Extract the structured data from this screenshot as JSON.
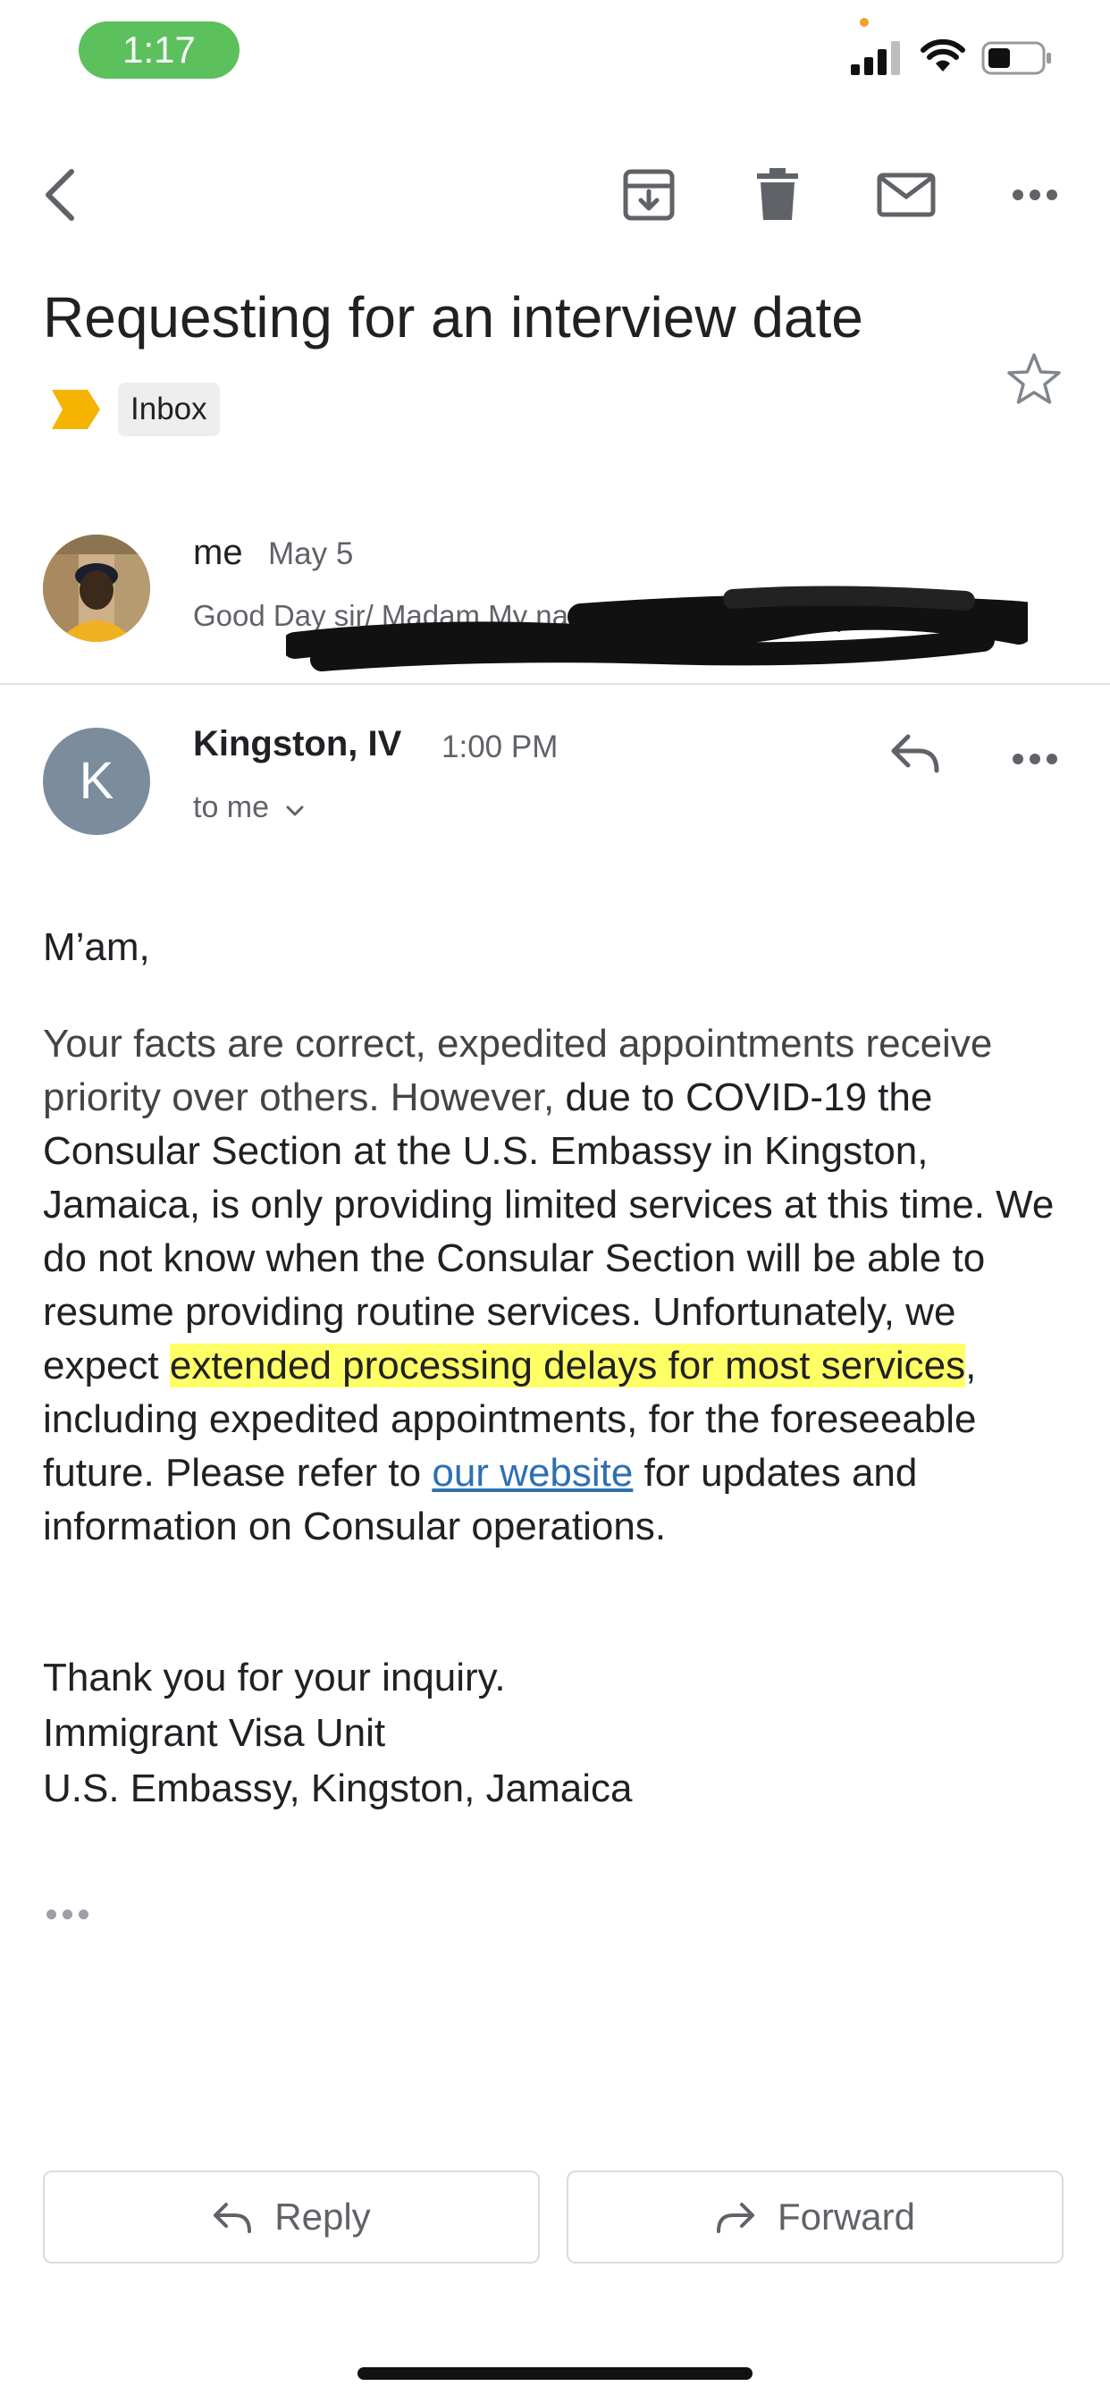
{
  "status_bar": {
    "time": "1:17",
    "icons": [
      "signal-icon",
      "wifi-icon",
      "battery-icon"
    ],
    "pill_color": "#5cc05c"
  },
  "toolbar": {
    "icons": [
      "back-icon",
      "archive-icon",
      "delete-icon",
      "mark-unread-icon",
      "more-icon"
    ]
  },
  "email": {
    "subject": "Requesting for an interview date",
    "label": "Inbox",
    "label_color": "#f4b400"
  },
  "thread": {
    "collapsed_message": {
      "sender": "me",
      "date": "May 5",
      "snippet": "Good Day sir/ Madam My name is Shannon Campbell, I..."
    },
    "message": {
      "avatar_letter": "K",
      "avatar_color": "#7b8c9c",
      "sender": "Kingston, IV",
      "time": "1:00 PM",
      "recipient": "to me",
      "body": {
        "greeting": "M’am,",
        "p_start": "Your facts are correct, expedited appointments receive priority over others.  However,",
        "p_mid": " due to COVID-19 the Consular Section at the U.S. Embassy in Kingston, Jamaica, is only providing limited services at this time.  We do not know when the Consular Section will be able to resume providing routine services.  Unfortunately, we expect ",
        "p_highlight": "extended processing delays for most services",
        "p_after": ", including expedited appointments, for the foreseeable future.  Please refer to ",
        "link_text": "our website",
        "p_end": " for updates and information on Consular operations.",
        "sign_1": "Thank you for your inquiry.",
        "sign_2": "Immigrant Visa Unit",
        "sign_3": "U.S. Embassy, Kingston, Jamaica"
      }
    }
  },
  "actions": {
    "reply": "Reply",
    "forward": "Forward"
  }
}
